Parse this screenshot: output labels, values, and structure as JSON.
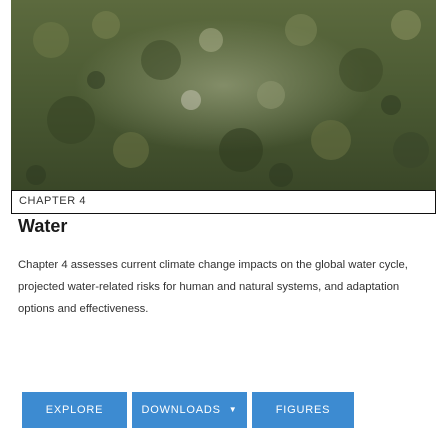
{
  "chapter": {
    "label": "CHAPTER 4",
    "title": "Water",
    "description": "Chapter 4 assesses current climate change impacts on the global water cycle, projected water-related risks for human and natural systems, and adaptation options and effectiveness."
  },
  "actions": {
    "explore_label": "EXPLORE",
    "downloads_label": "DOWNLOADS",
    "downloads_caret_icon": "caret-down-icon",
    "figures_label": "FIGURES"
  },
  "colors": {
    "button": "#3d8bd1",
    "button_text": "#ffffff",
    "border": "#111111"
  }
}
